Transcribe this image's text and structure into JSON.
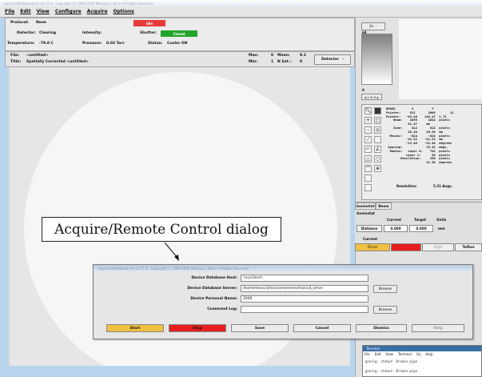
{
  "window": {
    "title": "marccd (MarResearch) v0.17.8 - Copyright (c) 1999-2005 Michael L. Blum All Rights Reserved"
  },
  "menu": [
    "File",
    "Edit",
    "View",
    "Configure",
    "Acquire",
    "Options"
  ],
  "status": {
    "protocol_label": "Protocol:",
    "protocol_value": "None",
    "idle_label": "Idle",
    "detector_label": "Detector:",
    "detector_value": "Clearing",
    "intensity_label": "Intensity:",
    "shutter_label": "Shutter:",
    "shutter_value": "Closed",
    "temperature_label": "Temperature:",
    "temperature_value": "-79.8 C",
    "pressure_label": "Pressure:",
    "pressure_value": "0.02 Torr",
    "status_label": "Status:",
    "status_value": "Cooler ON",
    "colors": {
      "idle": "#e63a3a",
      "closed": "#21a62a"
    }
  },
  "imageinfo": {
    "file_label": "File:",
    "file_value": "<untitled>",
    "title_label": "Title:",
    "title_value": "Spatially Corrected <untitled>",
    "max_label": "Max:",
    "max_value": "0",
    "mean_label": "Mean:",
    "mean_value": "9.1",
    "min_label": "Min:",
    "min_value": "1",
    "nsat_label": "N Sat.:",
    "nsat_value": "0",
    "detector_button": "Detector"
  },
  "right": {
    "zoom": "2x",
    "scale_top": "64",
    "scale_bottom": "0",
    "lmh": "◄ L M H ►",
    "stats_text": "DENZO         X          Y\nPointer:     812       2008        11\nPointer:   -63.86    148.47  1.73\n    Beam:    1056      1024  pixels\n            81.47     mm\n    Zone:     812       812  pixels\n            48.26     48.26  mm\n  Mosaic:    -824      -824  pixels\n           -41.21    -41.21  mm\n           -22.48    -22.48  degrees\n Spacing:             15.32  degs.\n  Radius:   Layer 0:    741  pixels\n           Layer 1:      28  pixels\n        Resolution:     256  pixels\n                      11.38  degrees",
    "resolution_label": "Resolution:",
    "resolution_value": "5.31 Angs.",
    "tabs": [
      "Goniostat",
      "Beam"
    ],
    "goniostat_label": "Goniostat",
    "table_headers": [
      "Current",
      "Target",
      "Units"
    ],
    "distance_label": "Distance",
    "distance_current": "0.000",
    "distance_target": "0.000",
    "distance_units": "mm",
    "current_label": "Current",
    "drive_label": "Drive",
    "align_label": "Align",
    "teflon_label": "Teflon",
    "colors": {
      "drive": "#f0c040",
      "red": "#e61e1e"
    }
  },
  "callout": {
    "text": "Acquire/Remote Control dialog"
  },
  "dialog": {
    "title": "marccd (MarResearch) v0.17.8 - Copyright (c) 1999-2005 Michael L. Blum All Rights Reserved",
    "host_label": "Device Database Host:",
    "host_value": "localhost",
    "server_label": "Device Database Server:",
    "server_value": "/home/marccd/source/servers/marccd_serve",
    "personal_label": "Device Personal Name:",
    "personal_value": "3000",
    "log_label": "Command Log:",
    "log_value": "",
    "browse1": "Browse",
    "browse2": "Browse",
    "buttons": {
      "start": "Start",
      "stop": "Stop",
      "save": "Save",
      "cancel": "Cancel",
      "dismiss": "Dismiss",
      "help": "Help"
    },
    "colors": {
      "start": "#f0c040",
      "stop": "#e61e1e"
    }
  },
  "terminal": {
    "title": "Terminal",
    "menu": [
      "File",
      "Edit",
      "View",
      "Terminal",
      "Go",
      "Help"
    ],
    "line1": "gnerig: stdout: Broken pipe",
    "line2": "gnerig: stdout: Broken pipe"
  }
}
